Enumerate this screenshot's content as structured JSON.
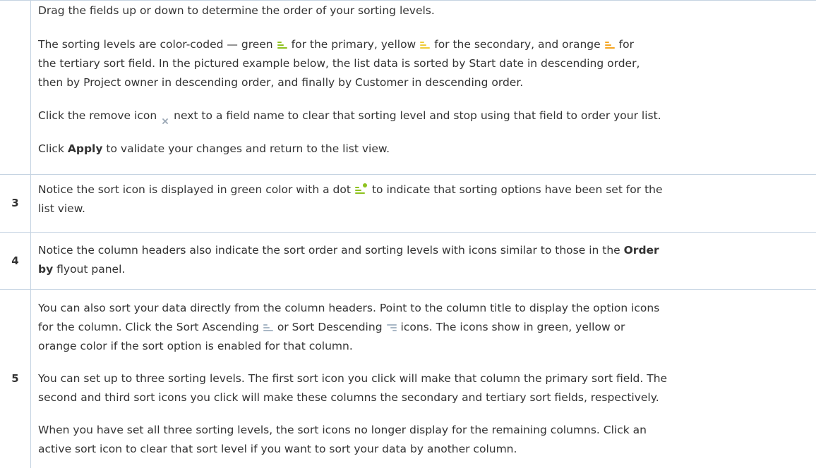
{
  "colors": {
    "primary": "#8ec21f",
    "secondary": "#f0cc3a",
    "tertiary": "#f5a623",
    "neutral": "#a9b8c6",
    "remove": "#9aa7b5"
  },
  "icons": [
    "sort-primary-green-icon",
    "sort-secondary-yellow-icon",
    "sort-tertiary-orange-icon",
    "remove-icon",
    "sort-active-dot-icon",
    "sort-ascending-icon",
    "sort-descending-icon"
  ],
  "row1": {
    "p1": "Drag the fields up or down to determine the order of your sorting levels.",
    "p2a": "The sorting levels are color-coded — green",
    "p2b": "for the primary, yellow",
    "p2c": "for the secondary, and orange",
    "p2d": "for",
    "p2e": "the tertiary sort field. In the pictured example below, the list data is sorted by Start date in descending order,",
    "p2f": "then by Project owner in descending order, and finally by Customer in descending order.",
    "p3a": "Click the remove icon",
    "p3b": "next to a field name to clear that sorting level and stop using that field to order your list.",
    "p4a": "Click",
    "p4bold": "Apply",
    "p4b": "to validate your changes and return to the list view."
  },
  "row3": {
    "number": "3",
    "a": "Notice the sort icon is displayed in green color with a dot",
    "b": "to indicate that sorting options have been set for the",
    "c": "list view."
  },
  "row4": {
    "number": "4",
    "a": "Notice the column headers also indicate the sort order and sorting levels with icons similar to those in the",
    "bold1": "Order",
    "bold2": "by",
    "b": "flyout panel."
  },
  "row5": {
    "number": "5",
    "p1a": "You can also sort your data directly from the column headers. Point to the column title to display the option icons",
    "p1b": "for the column. Click the Sort Ascending",
    "p1c": "or Sort Descending",
    "p1d": "icons. The icons show in green, yellow or",
    "p1e": "orange color if the sort option is enabled for that column.",
    "p2a": "You can set up to three sorting levels. The first sort icon you click will make that column the primary sort field. The",
    "p2b": "second and third sort icons you click will make these columns the secondary and tertiary sort fields, respectively.",
    "p3a": "When you have set all three sorting levels, the sort icons no longer display for the remaining columns. Click an",
    "p3b": "active sort icon to clear that sort level if you want to sort your data by another column."
  }
}
